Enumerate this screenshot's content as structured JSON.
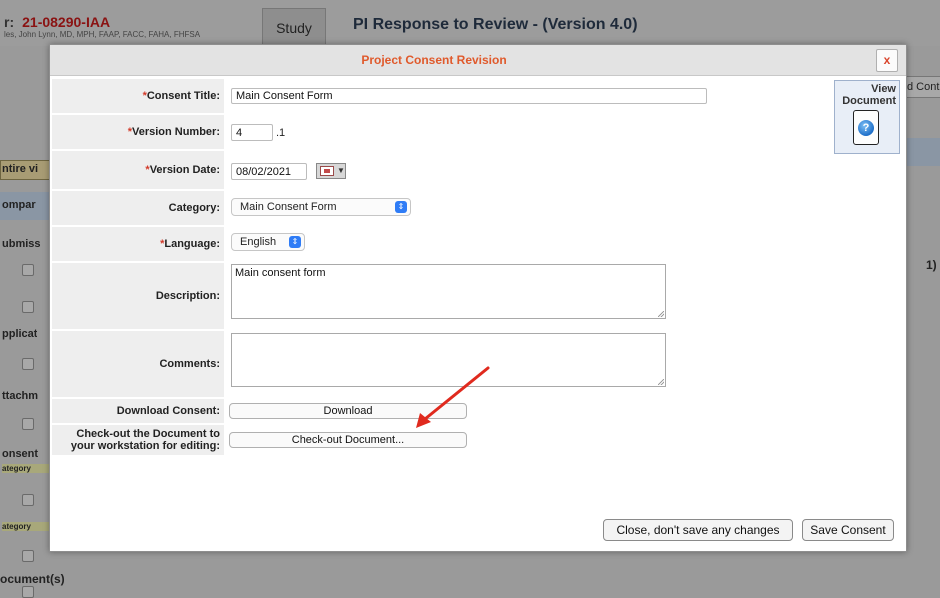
{
  "background": {
    "record_prefix": "r:",
    "record_id": "21-08290-IAA",
    "person": "les, John Lynn, MD, MPH, FAAP, FACC, FAHA, FHFSA",
    "study_tab": "Study",
    "page_title": "PI Response to Review - (Version 4.0)",
    "left_labels": [
      "ntire vi",
      "ompar",
      "ubmiss",
      "pplicat",
      "ttachm",
      "onsent",
      "ategory",
      "ategory"
    ],
    "right_button": "d Cont",
    "right_text": "1)",
    "bottom_label": "ocument(s)"
  },
  "modal": {
    "title": "Project Consent Revision",
    "close_label": "x",
    "view_document_label": "View Document",
    "fields": {
      "consent_title": {
        "label": "Consent Title:",
        "required_mark": "*",
        "value": "Main Consent Form"
      },
      "version_number": {
        "label": "Version Number:",
        "required_mark": "*",
        "major": "4",
        "minor": ".1"
      },
      "version_date": {
        "label": "Version Date:",
        "required_mark": "*",
        "value": "08/02/2021"
      },
      "category": {
        "label": "Category:",
        "value": "Main Consent Form"
      },
      "language": {
        "label": "Language:",
        "required_mark": "* ",
        "value": "English"
      },
      "description": {
        "label": "Description:",
        "value": "Main consent form"
      },
      "comments": {
        "label": "Comments:",
        "value": ""
      },
      "download": {
        "label": "Download Consent:",
        "button": "Download"
      },
      "checkout": {
        "label": "Check-out the Document to your workstation for editing:",
        "button": "Check-out Document..."
      }
    },
    "footer": {
      "close_button": "Close, don't save any changes",
      "save_button": "Save Consent"
    }
  },
  "colors": {
    "title": "#e05a2c",
    "required": "#d23a2a",
    "annotation_arrow": "#e02a1e",
    "select_chevron": "#2f7cf6"
  }
}
